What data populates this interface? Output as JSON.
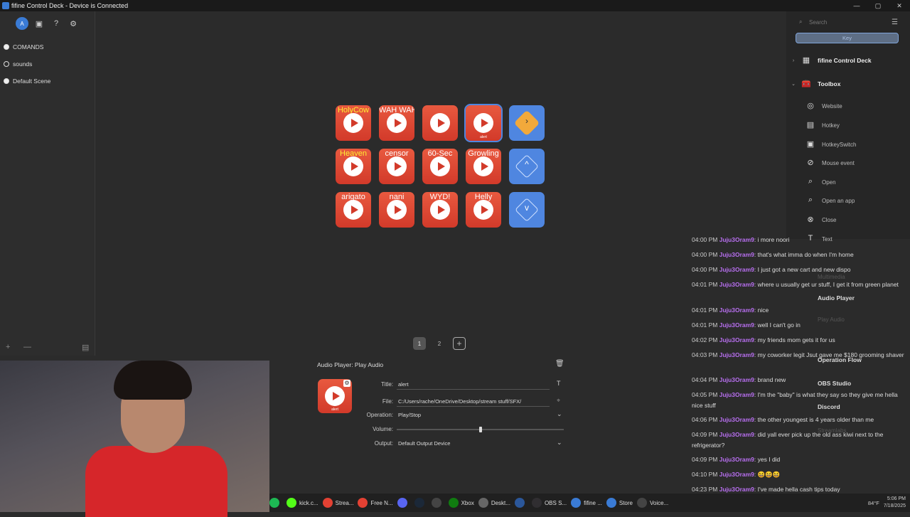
{
  "window": {
    "title": "fifine Control Deck - Device is Connected",
    "min": "—",
    "max": "▢",
    "close": "✕"
  },
  "sidebar": {
    "tools": [
      "A",
      "▣",
      "?",
      "⚙"
    ],
    "scenes": [
      {
        "label": "COMANDS",
        "selected": true
      },
      {
        "label": "sounds",
        "selected": false
      },
      {
        "label": "Default Scene",
        "selected": true
      }
    ],
    "footer": {
      "add": "+",
      "remove": "—",
      "grid": "▤"
    }
  },
  "grid": [
    {
      "label": "HolyCow",
      "color": "yellow",
      "type": "audio"
    },
    {
      "label": "WAH WAH",
      "color": "white",
      "type": "audio"
    },
    {
      "label": "",
      "color": "white",
      "type": "audio"
    },
    {
      "label": "",
      "color": "white",
      "type": "audio",
      "sub": "alert",
      "selected": true
    },
    {
      "label": "",
      "type": "folder"
    },
    {
      "label": "Heaven",
      "color": "yellow",
      "type": "audio"
    },
    {
      "label": "censor",
      "color": "white",
      "type": "audio"
    },
    {
      "label": "60-Sec",
      "color": "white",
      "type": "audio"
    },
    {
      "label": "Growling",
      "color": "white",
      "type": "audio"
    },
    {
      "label": "",
      "type": "up"
    },
    {
      "label": "arigato",
      "color": "white",
      "type": "audio"
    },
    {
      "label": "nani",
      "color": "white",
      "type": "audio"
    },
    {
      "label": "WYD!",
      "color": "white",
      "type": "audio"
    },
    {
      "label": "Helly",
      "color": "white",
      "type": "audio"
    },
    {
      "label": "",
      "type": "down"
    }
  ],
  "pages": [
    "1",
    "2",
    "+"
  ],
  "inspector": {
    "heading": "Audio Player: Play Audio",
    "preview_sub": "alert",
    "title_label": "Title:",
    "title_value": "alert",
    "file_label": "File:",
    "file_value": "C:/Users/rache/OneDrive/Desktop/stream stuff/SFX/",
    "operation_label": "Operation:",
    "operation_value": "Play/Stop",
    "volume_label": "Volume:",
    "volume": 0.5,
    "output_label": "Output:",
    "output_value": "Default Output Device",
    "title_font_btn": "T"
  },
  "right": {
    "search_placeholder": "Search",
    "key_btn": "Key",
    "tree": [
      {
        "label": "fifine Control Deck",
        "level": 0,
        "chev": "›",
        "icon": "▦"
      },
      {
        "label": "Toolbox",
        "level": 0,
        "chev": "⌄",
        "icon": "🧰"
      },
      {
        "label": "Website",
        "level": 1,
        "icon": "◎"
      },
      {
        "label": "Hotkey",
        "level": 1,
        "icon": "▤"
      },
      {
        "label": "HotkeySwitch",
        "level": 1,
        "icon": "▣"
      },
      {
        "label": "Mouse event",
        "level": 1,
        "icon": "⊘"
      },
      {
        "label": "Open",
        "level": 1,
        "icon": "⌕"
      },
      {
        "label": "Open an app",
        "level": 1,
        "icon": "⌕"
      },
      {
        "label": "Close",
        "level": 1,
        "icon": "⊗"
      },
      {
        "label": "Text",
        "level": 1,
        "icon": "T"
      }
    ],
    "overlay": {
      "audio_player": "Audio Player",
      "play_audio": "Play Audio",
      "operation_flow": "Operation Flow",
      "obs_studio": "OBS Studio",
      "discord": "Discord",
      "streamlabs": "Streamlabs",
      "multimedia": "Multimedia"
    }
  },
  "chat": [
    {
      "time": "04:00 PM",
      "user": "Juju3Oram9",
      "text": ": i more noori"
    },
    {
      "time": "04:00 PM",
      "user": "Juju3Oram9",
      "text": ": that's what imma do when I'm home"
    },
    {
      "time": "04:00 PM",
      "user": "Juju3Oram9",
      "text": ": I just got a new cart and new dispo"
    },
    {
      "time": "04:01 PM",
      "user": "Juju3Oram9",
      "text": ": where u usually get ur stuff, I get it from green planet"
    },
    {
      "time": "04:01 PM",
      "user": "Juju3Oram9",
      "text": ": nice"
    },
    {
      "time": "04:01 PM",
      "user": "Juju3Oram9",
      "text": ": well I can't go in"
    },
    {
      "time": "04:02 PM",
      "user": "Juju3Oram9",
      "text": ": my friends mom gets it for us"
    },
    {
      "time": "04:03 PM",
      "user": "Juju3Oram9",
      "text": ": my coworker legit Jsut gave me $180 grooming shaver"
    },
    {
      "time": "04:04 PM",
      "user": "Juju3Oram9",
      "text": ": brand new"
    },
    {
      "time": "04:05 PM",
      "user": "Juju3Oram9",
      "text": ": I'm the \"baby\" is what they say so they give me hella nice stuff"
    },
    {
      "time": "04:06 PM",
      "user": "Juju3Oram9",
      "text": ": the other youngest is 4 years older than me"
    },
    {
      "time": "04:09 PM",
      "user": "Juju3Oram9",
      "text": ": did yall ever pick up the old ass kiwi next to the refrigerator?"
    },
    {
      "time": "04:09 PM",
      "user": "Juju3Oram9",
      "text": ": yes I did"
    },
    {
      "time": "04:10 PM",
      "user": "Juju3Oram9",
      "text": ": 😆😆😆"
    },
    {
      "time": "04:23 PM",
      "user": "Juju3Oram9",
      "text": ": I've made hella cash tips today"
    }
  ],
  "taskbar": {
    "apps": [
      {
        "label": "",
        "color": "#1db954"
      },
      {
        "label": "kick.c...",
        "color": "#53fc18"
      },
      {
        "label": "Strea...",
        "color": "#e34133"
      },
      {
        "label": "Free N...",
        "color": "#e34133"
      },
      {
        "label": "",
        "color": "#5865f2"
      },
      {
        "label": "",
        "color": "#1b2838"
      },
      {
        "label": "",
        "color": "#444444"
      },
      {
        "label": "Xbox",
        "color": "#107c10"
      },
      {
        "label": "Deskt...",
        "color": "#666666"
      },
      {
        "label": "",
        "color": "#2b579a"
      },
      {
        "label": "OBS S...",
        "color": "#302e31"
      },
      {
        "label": "fifine ...",
        "color": "#3a7bd5"
      },
      {
        "label": "Store",
        "color": "#3a7bd5"
      },
      {
        "label": "Voice...",
        "color": "#444444"
      }
    ],
    "weather": "84°F",
    "time": "5:06 PM",
    "date": "7/18/2025"
  }
}
